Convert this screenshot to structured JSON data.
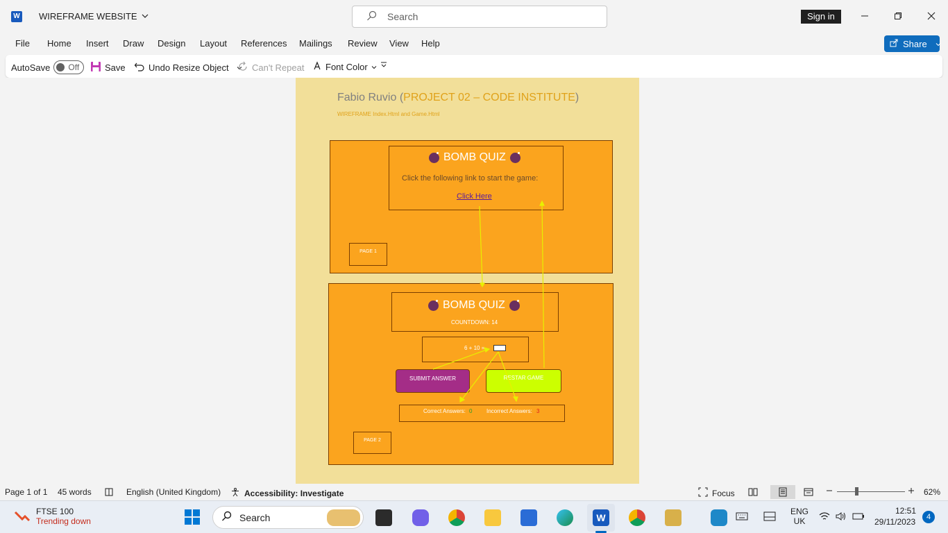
{
  "app": {
    "title": "WIREFRAME WEBSITE",
    "search_placeholder": "Search",
    "signin_label": "Sign in",
    "share_label": "Share"
  },
  "menu": [
    "File",
    "Home",
    "Insert",
    "Draw",
    "Design",
    "Layout",
    "References",
    "Mailings",
    "Review",
    "View",
    "Help"
  ],
  "qat": {
    "autosave_label": "AutoSave",
    "autosave_state": "Off",
    "save_label": "Save",
    "undo_label": "Undo Resize Object",
    "repeat_label": "Can't Repeat",
    "font_color_label": "Font Color"
  },
  "document": {
    "author": "Fabio Ruvio (",
    "project": "PROJECT 02 – CODE INSTITUTE",
    "close_paren": ")",
    "subtitle": "WIREFRAME Index.Html and Game.Html",
    "page1": {
      "title": "BOMB QUIZ",
      "instruction": "Click the following link to start the game:",
      "link": "Click Here",
      "label": "PAGE 1"
    },
    "page2": {
      "title": "BOMB QUIZ",
      "countdown": "COUNTDOWN: 14",
      "question": "6 + 10 =",
      "submit": "SUBMIT ANSWER",
      "restart": "RESTAR GAME",
      "correct_label": "Correct Answers:",
      "correct_value": "0",
      "incorrect_label": "Incorrect Answers:",
      "incorrect_value": "3",
      "label": "PAGE 2"
    }
  },
  "status": {
    "page": "Page 1 of 1",
    "words": "45 words",
    "language": "English (United Kingdom)",
    "accessibility": "Accessibility: Investigate",
    "focus": "Focus",
    "zoom": "62%"
  },
  "taskbar": {
    "ftse_title": "FTSE 100",
    "ftse_sub": "Trending down",
    "search": "Search",
    "lang": "ENG",
    "region": "UK",
    "time": "12:51",
    "date": "29/11/2023",
    "notifications": "4"
  },
  "colors": {
    "accent_blue": "#0f6cbd",
    "orange_panel": "#fba41e",
    "page_bg": "#f2df99",
    "submit": "#a42d87",
    "restart": "#ccff00",
    "arrow": "#e8f000"
  }
}
